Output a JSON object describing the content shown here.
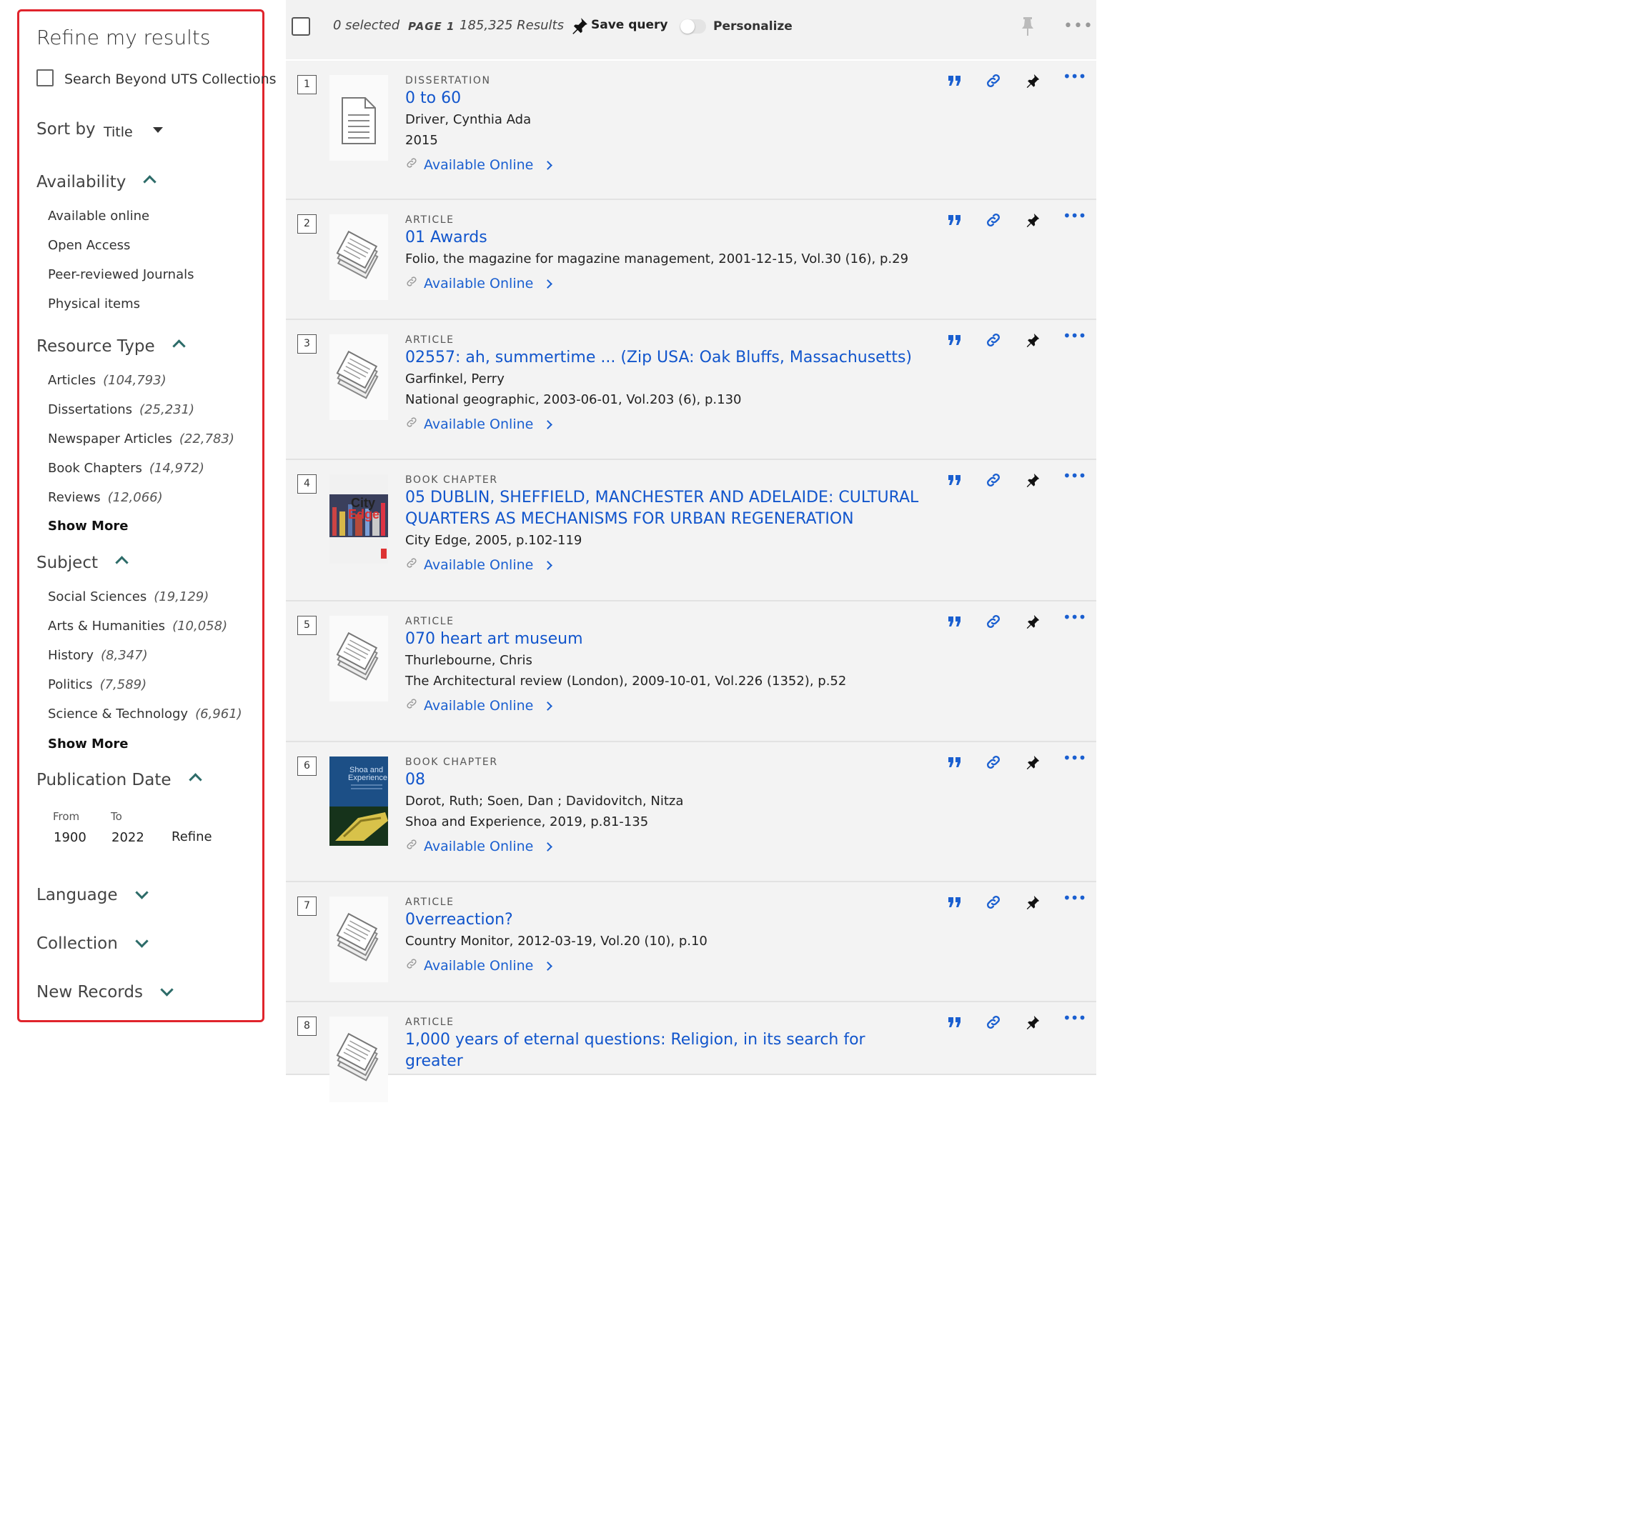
{
  "sidebar": {
    "title": "Refine my results",
    "search_beyond": "Search Beyond UTS Collections",
    "sort_label": "Sort by",
    "sort_value": "Title",
    "availability": {
      "heading": "Availability",
      "items": [
        "Available online",
        "Open Access",
        "Peer-reviewed Journals",
        "Physical items"
      ]
    },
    "resource_type": {
      "heading": "Resource Type",
      "items": [
        {
          "label": "Articles",
          "count": "(104,793)"
        },
        {
          "label": "Dissertations",
          "count": "(25,231)"
        },
        {
          "label": "Newspaper Articles",
          "count": "(22,783)"
        },
        {
          "label": "Book Chapters",
          "count": "(14,972)"
        },
        {
          "label": "Reviews",
          "count": "(12,066)"
        }
      ],
      "show_more": "Show More"
    },
    "subject": {
      "heading": "Subject",
      "items": [
        {
          "label": "Social Sciences",
          "count": "(19,129)"
        },
        {
          "label": "Arts & Humanities",
          "count": "(10,058)"
        },
        {
          "label": "History",
          "count": "(8,347)"
        },
        {
          "label": "Politics",
          "count": "(7,589)"
        },
        {
          "label": "Science & Technology",
          "count": "(6,961)"
        }
      ],
      "show_more": "Show More"
    },
    "publication_date": {
      "heading": "Publication Date",
      "from_label": "From",
      "to_label": "To",
      "from_value": "1900",
      "to_value": "2022",
      "refine": "Refine"
    },
    "language": "Language",
    "collection": "Collection",
    "new_records": "New Records"
  },
  "toolbar": {
    "selected": "0 selected",
    "page": "PAGE 1",
    "results": "185,325 Results",
    "save_query": "Save query",
    "personalize": "Personalize"
  },
  "results": [
    {
      "num": "1",
      "type": "Dissertation",
      "title": "0 to 60",
      "lines": [
        "Driver, Cynthia Ada",
        "2015"
      ],
      "avail": "Available Online",
      "thumb": "document"
    },
    {
      "num": "2",
      "type": "Article",
      "title": "01 Awards",
      "lines": [
        "Folio, the magazine for magazine management, 2001-12-15, Vol.30 (16), p.29"
      ],
      "avail": "Available Online",
      "thumb": "article"
    },
    {
      "num": "3",
      "type": "Article",
      "title": "02557: ah, summertime ... (Zip USA: Oak Bluffs, Massachusetts)",
      "lines": [
        "Garfinkel, Perry",
        "National geographic, 2003-06-01, Vol.203 (6), p.130"
      ],
      "avail": "Available Online",
      "thumb": "article"
    },
    {
      "num": "4",
      "type": "Book Chapter",
      "title": "05 DUBLIN, SHEFFIELD, MANCHESTER AND ADELAIDE: CULTURAL QUARTERS AS MECHANISMS FOR URBAN REGENERATION",
      "lines": [
        "City Edge, 2005, p.102-119"
      ],
      "avail": "Available Online",
      "thumb": "cover-cityedge",
      "cover_text": [
        "City",
        "Edge"
      ]
    },
    {
      "num": "5",
      "type": "Article",
      "title": "070 heart art museum",
      "lines": [
        "Thurlebourne, Chris",
        "The Architectural review (London), 2009-10-01, Vol.226 (1352), p.52"
      ],
      "avail": "Available Online",
      "thumb": "article"
    },
    {
      "num": "6",
      "type": "Book Chapter",
      "title": "08",
      "lines": [
        "Dorot, Ruth; Soen, Dan ; Davidovitch, Nitza",
        "Shoa and Experience, 2019, p.81-135"
      ],
      "avail": "Available Online",
      "thumb": "cover-shoa",
      "cover_text": [
        "Shoa and",
        "Experience"
      ]
    },
    {
      "num": "7",
      "type": "Article",
      "title": "0verreaction?",
      "lines": [
        "Country Monitor, 2012-03-19, Vol.20 (10), p.10"
      ],
      "avail": "Available Online",
      "thumb": "article"
    },
    {
      "num": "8",
      "type": "Article",
      "title": "1,000 years of eternal questions: Religion, in its search for greater",
      "lines": [],
      "avail": "",
      "thumb": "article"
    }
  ],
  "colors": {
    "link": "#1155cc",
    "sidebar_border": "#e0242c",
    "toolbar_bg": "#f2f2f2",
    "row_bg": "#f3f3f3",
    "chevron": "#2c6b68"
  },
  "icons": [
    "quote-icon",
    "link-icon",
    "pin-icon",
    "more-icon",
    "chain-icon"
  ]
}
